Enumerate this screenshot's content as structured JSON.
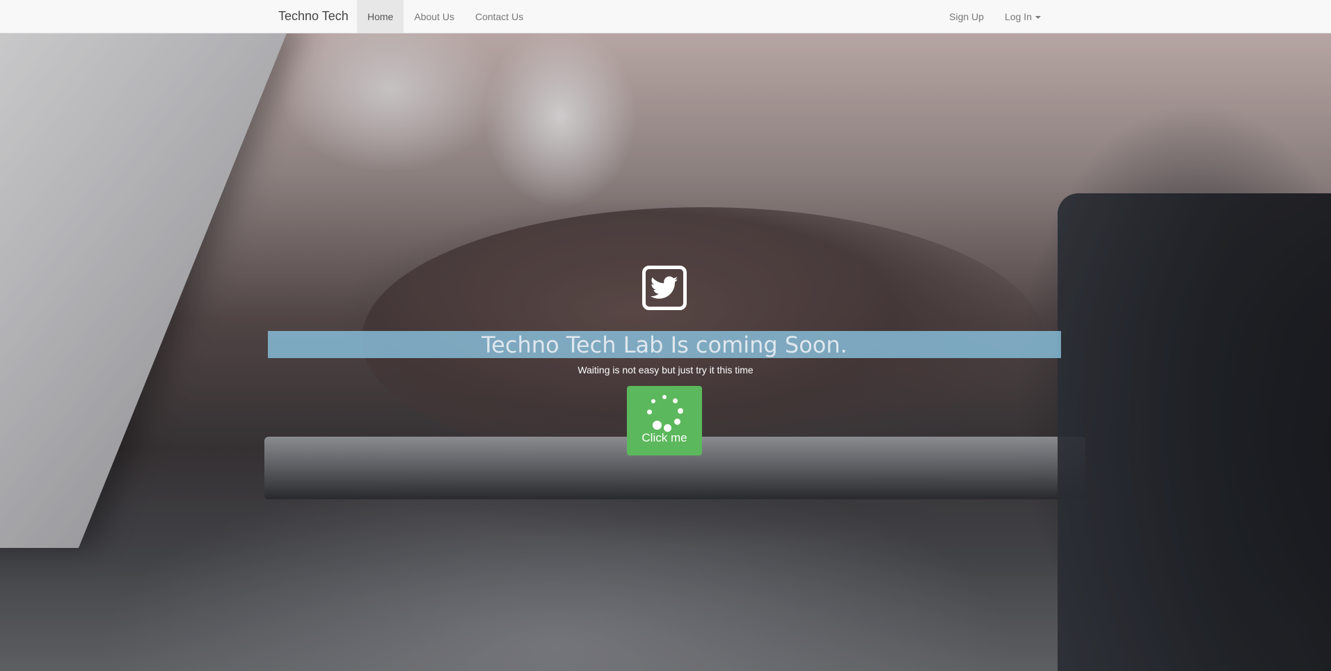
{
  "navbar": {
    "brand": "Techno Tech",
    "links": [
      {
        "label": "Home",
        "active": true
      },
      {
        "label": "About Us",
        "active": false
      },
      {
        "label": "Contact Us",
        "active": false
      }
    ],
    "right": {
      "signup": "Sign Up",
      "login": "Log In"
    }
  },
  "hero": {
    "icon": "twitter-icon",
    "headline": "Techno Tech Lab Is coming Soon.",
    "subtext": "Waiting is not easy but just try it this time",
    "button": {
      "label": "Click me",
      "icon": "spinner-icon",
      "color": "#5cb85c"
    },
    "headline_bar_color": "#8cc6e4"
  }
}
